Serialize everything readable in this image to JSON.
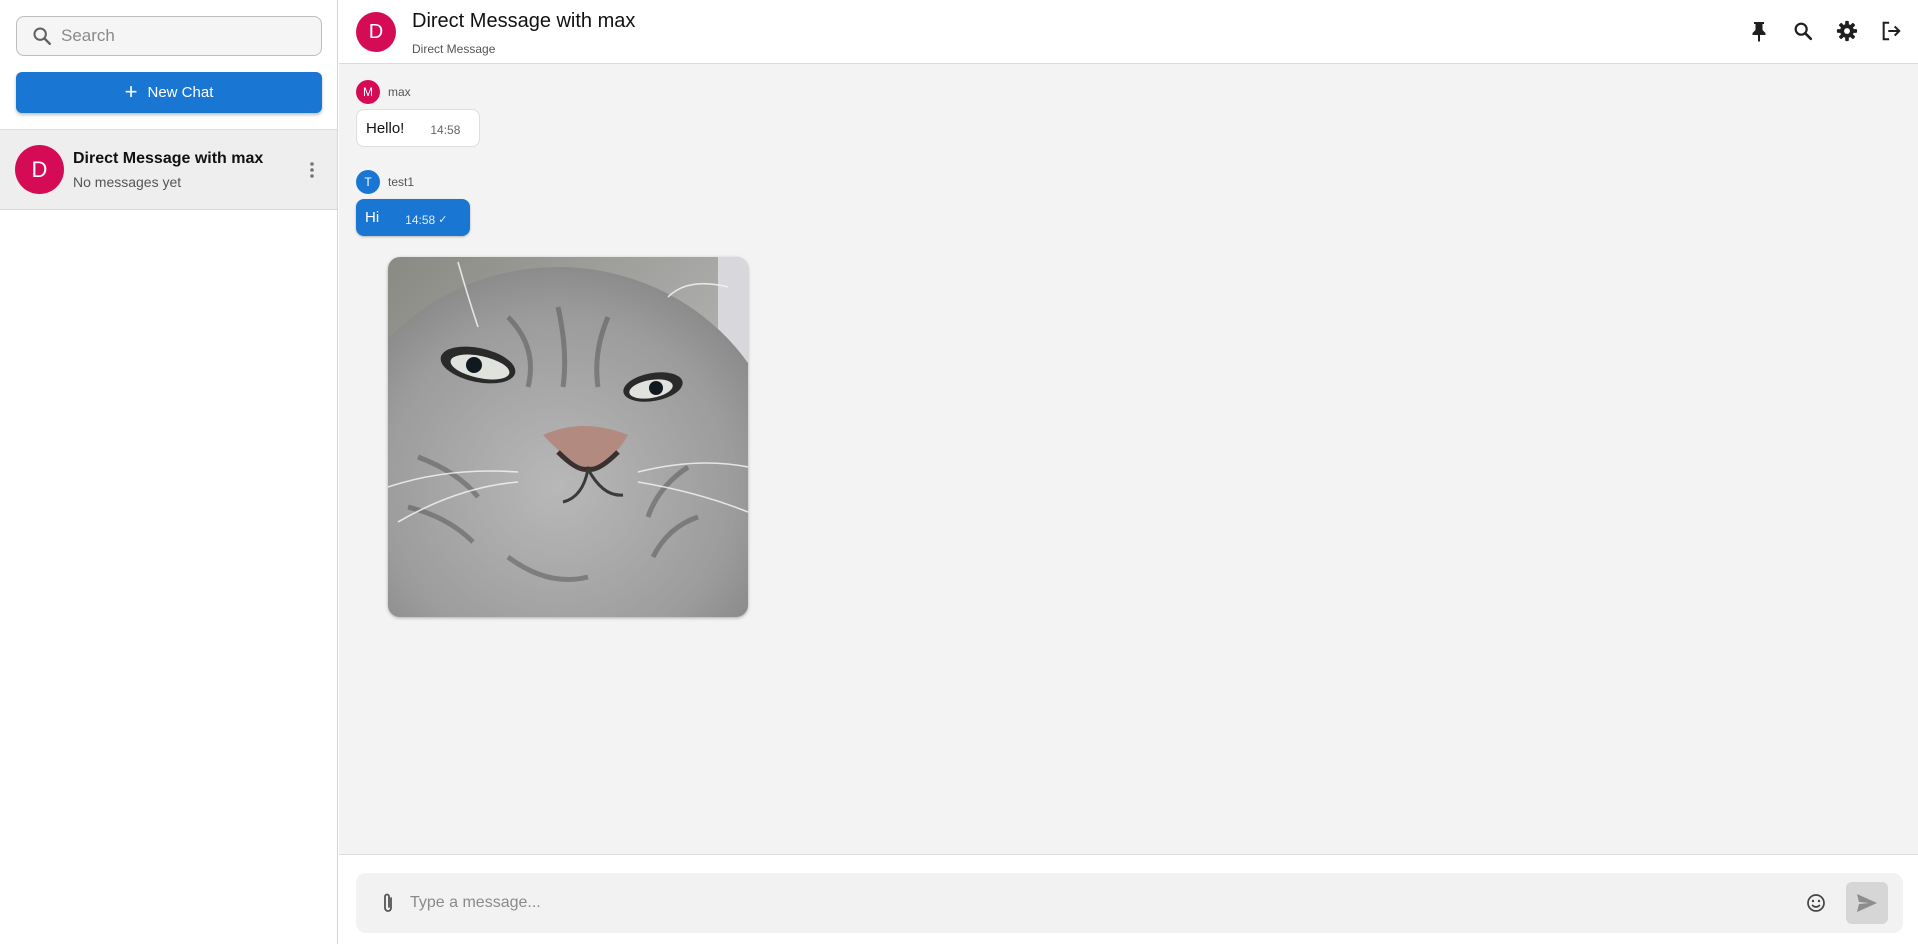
{
  "sidebar": {
    "search_placeholder": "Search",
    "new_chat_label": "New Chat",
    "chats": [
      {
        "avatar_letter": "D",
        "name": "Direct Message with max",
        "preview": "No messages yet",
        "avatar_color": "#d50b56"
      }
    ]
  },
  "header": {
    "avatar_letter": "D",
    "title": "Direct Message with max",
    "subtitle": "Direct Message",
    "actions": [
      "pin-icon",
      "search-icon",
      "settings-icon",
      "logout-icon"
    ]
  },
  "messages": [
    {
      "author": "max",
      "author_letter": "M",
      "author_color": "#d50b56",
      "text": "Hello!",
      "time": "14:58",
      "outgoing": false
    },
    {
      "author": "test1",
      "author_letter": "T",
      "author_color": "#1976d2",
      "text": "Hi",
      "time": "14:58",
      "outgoing": true,
      "read_mark": "✓"
    },
    {
      "type": "image",
      "image_subject": "tabby cat photo",
      "outgoing": true
    }
  ],
  "composer": {
    "placeholder": "Type a message..."
  },
  "colors": {
    "accent": "#1976d2",
    "avatar_red": "#d50b56",
    "main_bg": "#f3f3f3"
  }
}
